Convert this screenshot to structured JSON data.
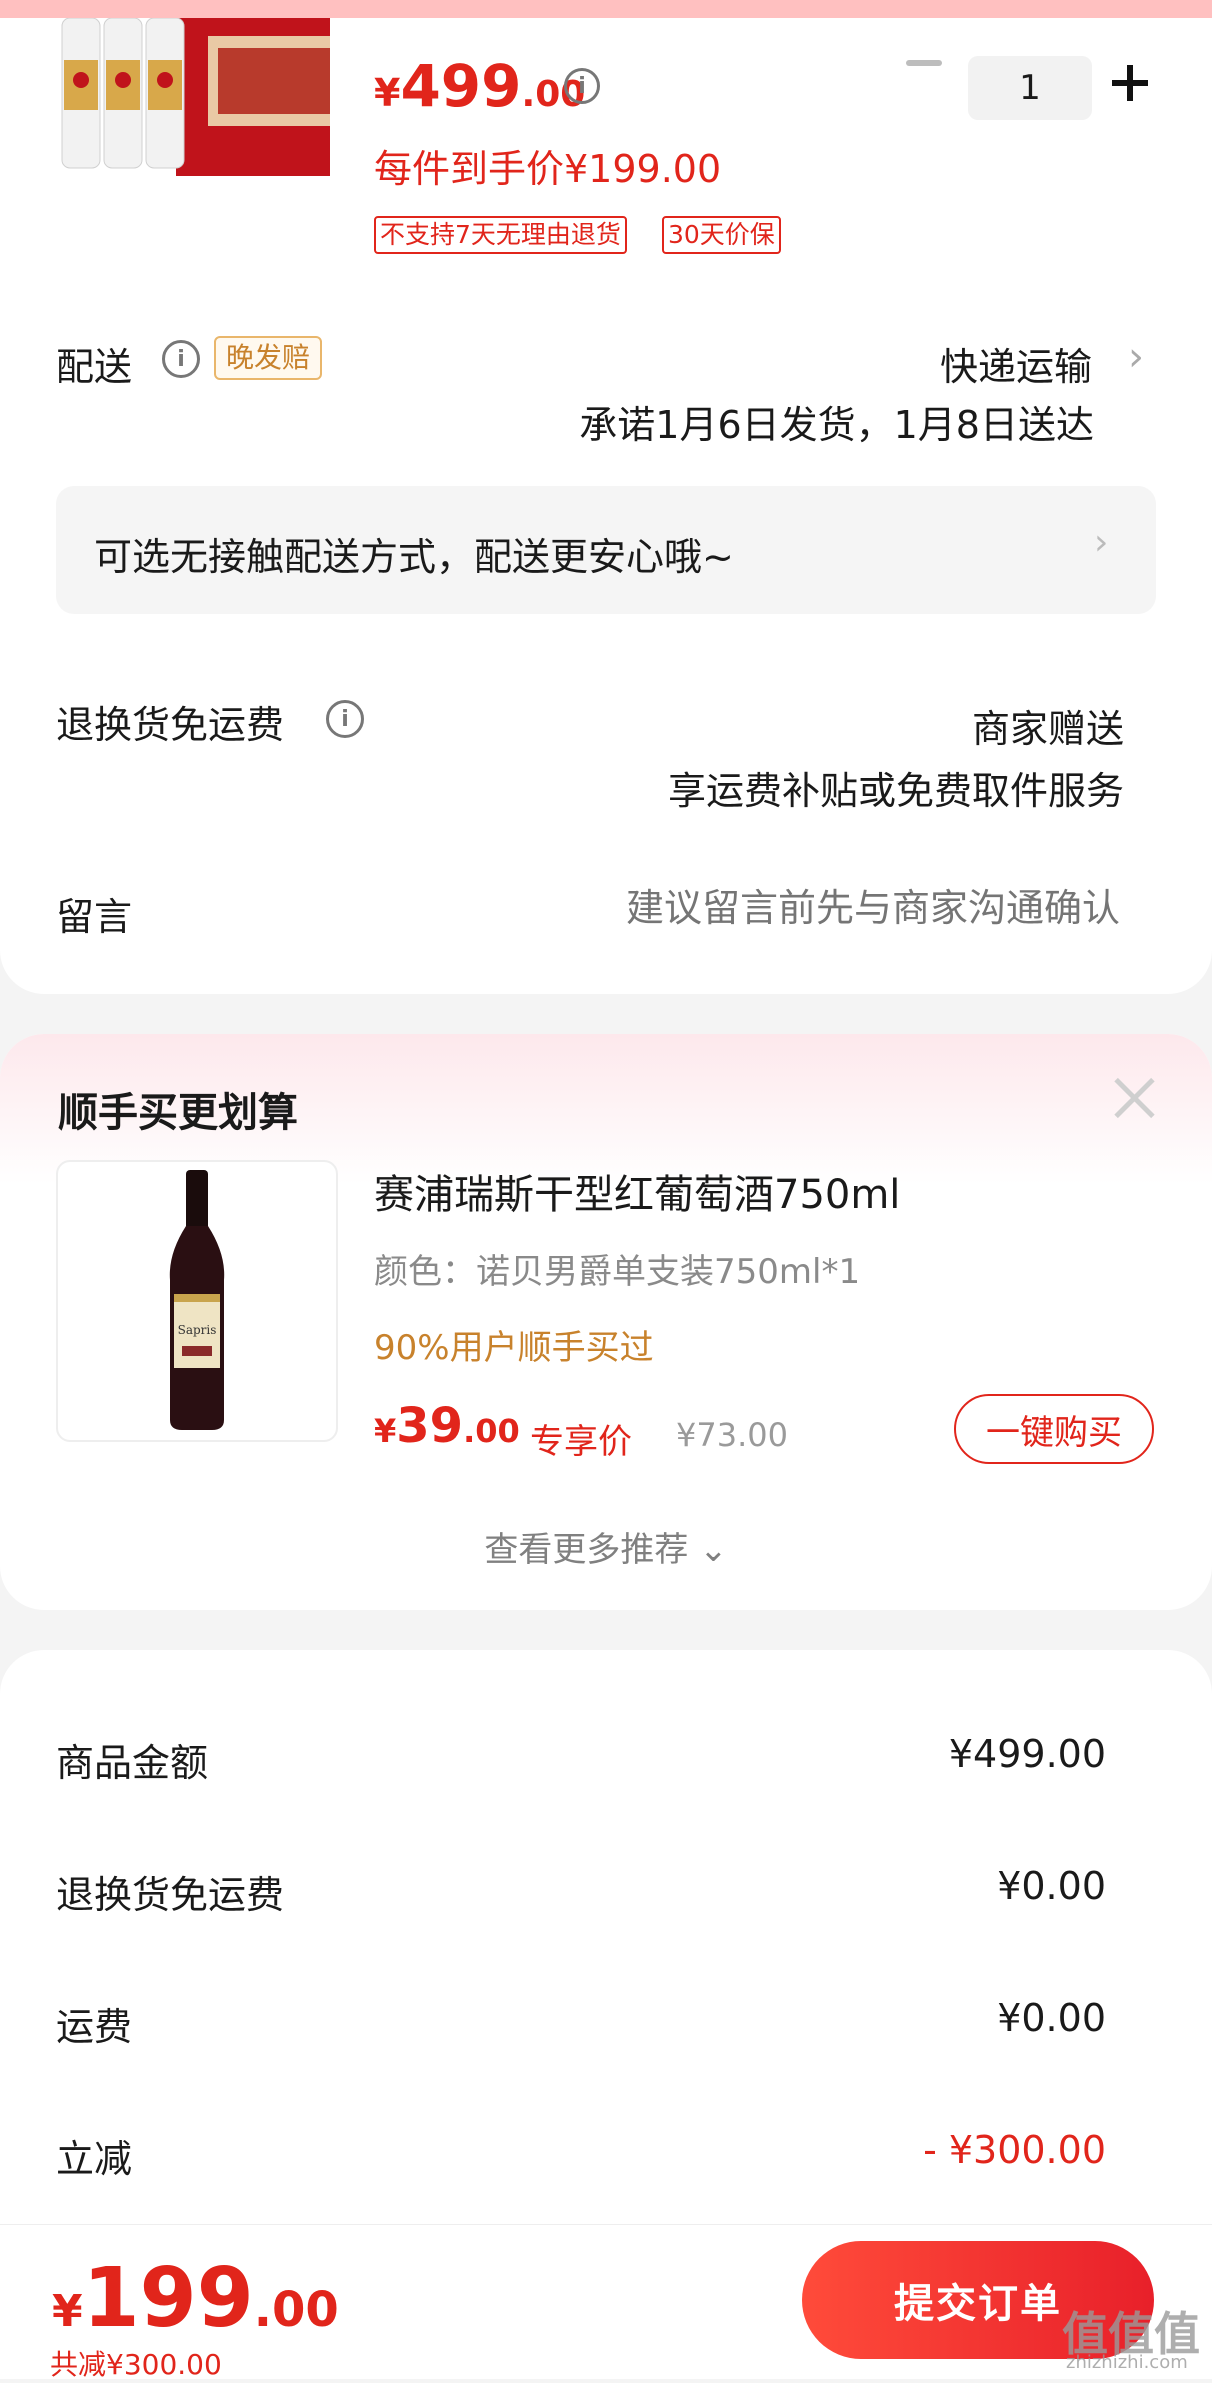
{
  "product": {
    "price_currency": "¥",
    "price_int": "499",
    "price_dec": ".00",
    "per_item_price": "每件到手价¥199.00",
    "tags": [
      "不支持7天无理由退货",
      "30天价保"
    ],
    "quantity": "1"
  },
  "delivery": {
    "label": "配送",
    "late_badge": "晚发赔",
    "method": "快递运输",
    "promise": "承诺1月6日发货，1月8日送达",
    "contactless": "可选无接触配送方式，配送更安心哦~"
  },
  "return_shipping": {
    "label": "退换货免运费",
    "line1": "商家赠送",
    "line2": "享运费补贴或免费取件服务"
  },
  "note": {
    "label": "留言",
    "placeholder": "建议留言前先与商家沟通确认"
  },
  "recommend": {
    "title": "顺手买更划算",
    "item_name": "赛浦瑞斯干型红葡萄酒750ml",
    "variant": "颜色：诺贝男爵单支装750ml*1",
    "social": "90%用户顺手买过",
    "price_currency": "¥",
    "price_int": "39",
    "price_dec": ".00",
    "exclusive_label": "专享价",
    "original_price": "¥73.00",
    "buy_label": "一键购买",
    "bottle_label": "Sapris",
    "see_more": "查看更多推荐"
  },
  "summary": {
    "rows": [
      {
        "label": "商品金额",
        "value": "¥499.00"
      },
      {
        "label": "退换货免运费",
        "value": "¥0.00"
      },
      {
        "label": "运费",
        "value": "¥0.00"
      },
      {
        "label": "立减",
        "value": "- ¥300.00"
      }
    ]
  },
  "bottom": {
    "total_currency": "¥",
    "total_int": "199",
    "total_dec": ".00",
    "saved": "共减¥300.00",
    "submit_label": "提交订单"
  },
  "watermark": {
    "text": "值值值",
    "sub": "zhizhizhi.com"
  },
  "colors": {
    "accent": "#e1251b",
    "badge_orange": "#c8822c",
    "page_bg": "#f4f4f4"
  }
}
